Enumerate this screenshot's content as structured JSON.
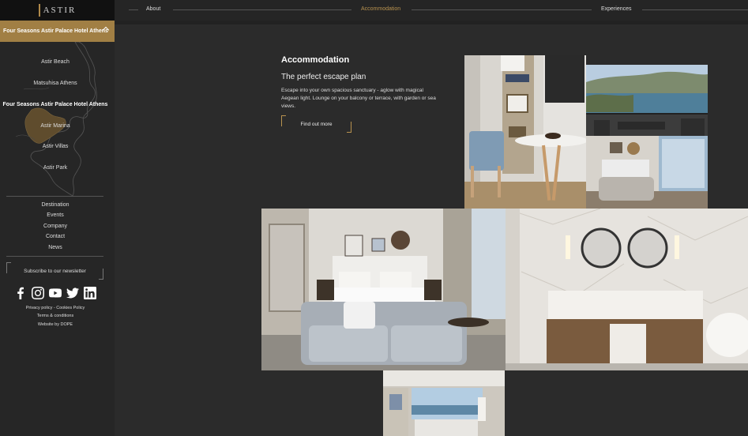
{
  "brand": {
    "logo_text": "ASTIR"
  },
  "sidebar": {
    "active_hotel": "Four Seasons Astir Palace Hotel Athens",
    "hotels": [
      {
        "label": "Astir Beach"
      },
      {
        "label": "Matsuhisa Athens"
      },
      {
        "label": "Four Seasons Astir Palace Hotel Athens"
      },
      {
        "label": "Astir Marina"
      },
      {
        "label": "Astir Villas"
      },
      {
        "label": "Astir Park"
      }
    ],
    "nav": [
      {
        "label": "Destination"
      },
      {
        "label": "Events"
      },
      {
        "label": "Company"
      },
      {
        "label": "Contact"
      },
      {
        "label": "News"
      }
    ],
    "newsletter": "Subscribe to our newsletter",
    "social_icons": [
      "facebook-icon",
      "instagram-icon",
      "youtube-icon",
      "twitter-icon",
      "linkedin-icon"
    ],
    "legal": {
      "privacy_policy": "Privacy policy",
      "separator": " - ",
      "cookies_policy": "Cookies Policy",
      "terms": "Terms & conditions",
      "credit": "Website by DOPE"
    }
  },
  "topnav": {
    "items": [
      {
        "label": "About",
        "active": false
      },
      {
        "label": "Accommodation",
        "active": true
      },
      {
        "label": "Experiences",
        "active": false
      }
    ]
  },
  "content": {
    "title": "Accommodation",
    "subtitle": "The perfect escape plan",
    "description": "Escape into your own spacious sanctuary - aglow with magical Aegean light. Lounge on your balcony or terrace, with garden or sea views.",
    "cta": "Find out more"
  },
  "colors": {
    "accent": "#a17f44",
    "accent_text": "#b8924f",
    "background": "#2b2b2b",
    "sidebar": "#262626"
  }
}
